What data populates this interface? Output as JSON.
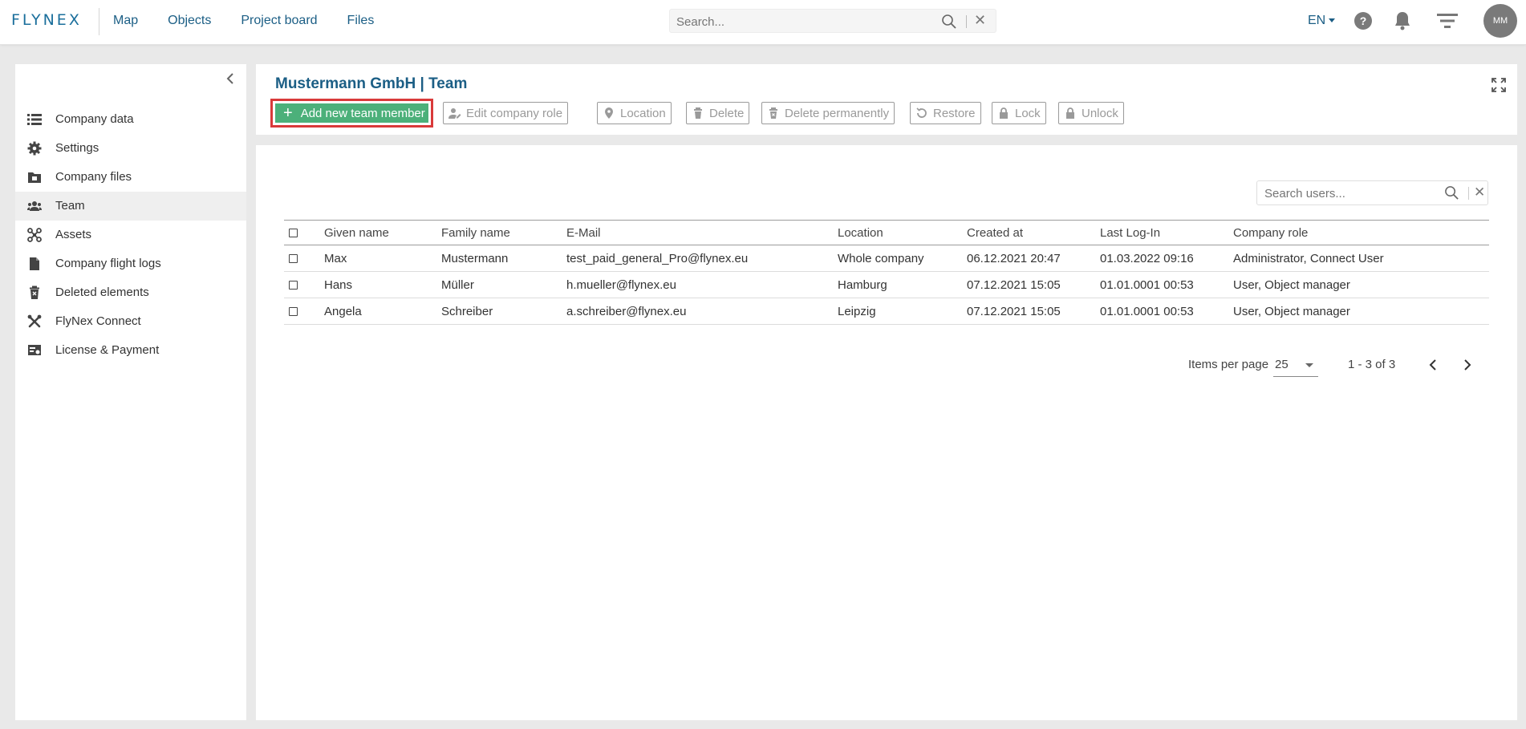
{
  "app": {
    "logo": "FLYNEX"
  },
  "topnav": {
    "items": [
      "Map",
      "Objects",
      "Project board",
      "Files"
    ]
  },
  "global_search": {
    "placeholder": "Search..."
  },
  "user_menu": {
    "language": "EN",
    "avatar_initials": "MM"
  },
  "sidebar": {
    "items": [
      {
        "label": "Company data",
        "icon": "list-icon"
      },
      {
        "label": "Settings",
        "icon": "gear-icon"
      },
      {
        "label": "Company files",
        "icon": "folder-icon"
      },
      {
        "label": "Team",
        "icon": "users-icon",
        "active": true
      },
      {
        "label": "Assets",
        "icon": "drone-icon"
      },
      {
        "label": "Company flight logs",
        "icon": "document-icon"
      },
      {
        "label": "Deleted elements",
        "icon": "trash-icon"
      },
      {
        "label": "FlyNex Connect",
        "icon": "tools-icon"
      },
      {
        "label": "License & Payment",
        "icon": "license-icon"
      }
    ]
  },
  "header": {
    "title": "Mustermann GmbH | Team",
    "buttons": {
      "add": "Add new team member",
      "edit_role": "Edit company role",
      "location": "Location",
      "delete": "Delete",
      "delete_permanently": "Delete permanently",
      "restore": "Restore",
      "lock": "Lock",
      "unlock": "Unlock"
    }
  },
  "user_search": {
    "placeholder": "Search users..."
  },
  "table": {
    "columns": [
      "Given name",
      "Family name",
      "E-Mail",
      "Location",
      "Created at",
      "Last Log-In",
      "Company role"
    ],
    "rows": [
      [
        "Max",
        "Mustermann",
        "test_paid_general_Pro@flynex.eu",
        "Whole company",
        "06.12.2021 20:47",
        "01.03.2022 09:16",
        "Administrator, Connect User"
      ],
      [
        "Hans",
        "Müller",
        "h.mueller@flynex.eu",
        "Hamburg",
        "07.12.2021 15:05",
        "01.01.0001 00:53",
        "User, Object manager"
      ],
      [
        "Angela",
        "Schreiber",
        "a.schreiber@flynex.eu",
        "Leipzig",
        "07.12.2021 15:05",
        "01.01.0001 00:53",
        "User, Object manager"
      ]
    ]
  },
  "pagination": {
    "items_per_page_label": "Items per page",
    "items_per_page": "25",
    "range": "1 - 3 of 3"
  },
  "colors": {
    "brand": "#1b5e85",
    "add_button": "#4cb07a",
    "highlight": "#d93a3a"
  }
}
